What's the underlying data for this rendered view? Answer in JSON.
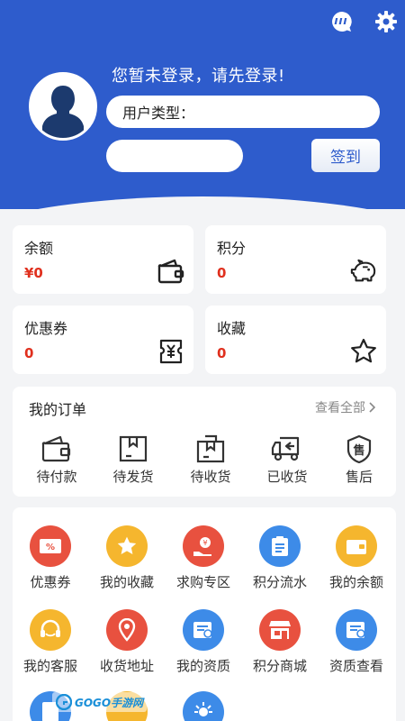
{
  "header": {
    "login_tip": "您暂未登录，请先登录!",
    "user_type_label": "用户类型：",
    "sign_in_label": "签到",
    "chat_icon": "chat-bubble-icon",
    "settings_icon": "gear-icon"
  },
  "stats": [
    {
      "title": "余额",
      "value": "¥0",
      "icon": "wallet-icon"
    },
    {
      "title": "积分",
      "value": "0",
      "icon": "piggy-bank-icon"
    },
    {
      "title": "优惠券",
      "value": "0",
      "icon": "ticket-icon"
    },
    {
      "title": "收藏",
      "value": "0",
      "icon": "star-icon"
    }
  ],
  "orders": {
    "title": "我的订单",
    "view_all": "查看全部",
    "items": [
      {
        "label": "待付款",
        "icon": "wallet-icon"
      },
      {
        "label": "待发货",
        "icon": "box-icon"
      },
      {
        "label": "待收货",
        "icon": "package-icon"
      },
      {
        "label": "已收货",
        "icon": "truck-icon"
      },
      {
        "label": "售后",
        "icon": "after-sale-icon"
      }
    ]
  },
  "services": [
    {
      "label": "优惠券",
      "icon": "coupon-icon",
      "color": "#e8513f"
    },
    {
      "label": "我的收藏",
      "icon": "star-icon",
      "color": "#f5b62e"
    },
    {
      "label": "求购专区",
      "icon": "hand-coin-icon",
      "color": "#e8513f"
    },
    {
      "label": "积分流水",
      "icon": "clipboard-icon",
      "color": "#3d8be8"
    },
    {
      "label": "我的余额",
      "icon": "wallet-icon",
      "color": "#f5b62e"
    },
    {
      "label": "我的客服",
      "icon": "headset-icon",
      "color": "#f5b62e"
    },
    {
      "label": "收货地址",
      "icon": "location-pin-icon",
      "color": "#e8513f"
    },
    {
      "label": "我的资质",
      "icon": "certificate-icon",
      "color": "#3d8be8"
    },
    {
      "label": "积分商城",
      "icon": "shop-icon",
      "color": "#e8513f"
    },
    {
      "label": "资质查看",
      "icon": "certificate-icon",
      "color": "#3d8be8"
    },
    {
      "label": "",
      "icon": "document-icon",
      "color": "#3d8be8"
    },
    {
      "label": "",
      "icon": "document-icon",
      "color": "#f5b62e"
    },
    {
      "label": "",
      "icon": "lightbulb-icon",
      "color": "#3d8be8"
    }
  ],
  "watermark": {
    "text": "GOGO手游网"
  },
  "colors": {
    "brand_blue": "#2e5ccc",
    "value_red": "#e0301e",
    "page_bg": "#f3f4f6"
  }
}
